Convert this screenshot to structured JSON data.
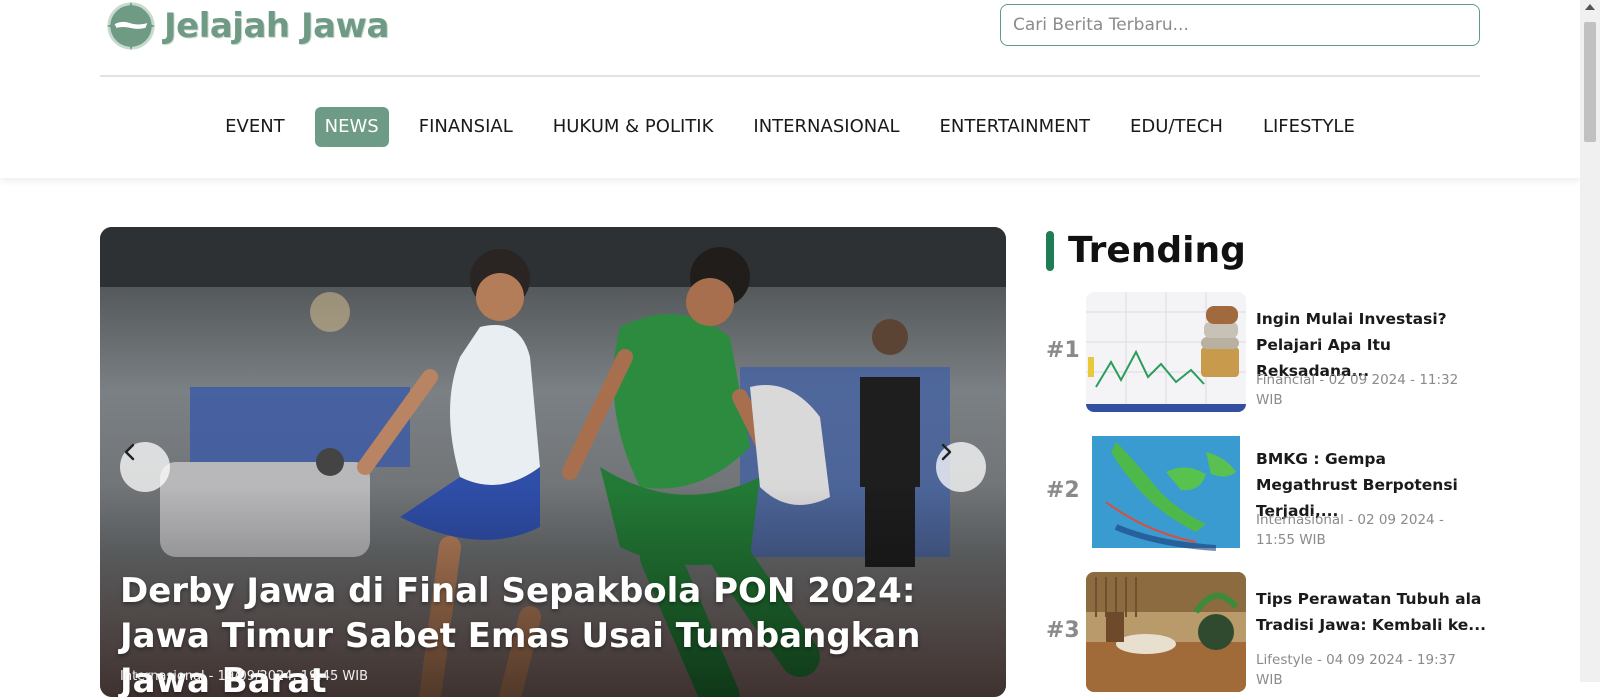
{
  "header": {
    "logo_text": "Jelajah Jawa",
    "search_placeholder": "Cari Berita Terbaru..."
  },
  "nav": {
    "items": [
      {
        "label": "EVENT",
        "active": false
      },
      {
        "label": "NEWS",
        "active": true
      },
      {
        "label": "FINANSIAL",
        "active": false
      },
      {
        "label": "HUKUM & POLITIK",
        "active": false
      },
      {
        "label": "INTERNASIONAL",
        "active": false
      },
      {
        "label": "ENTERTAINMENT",
        "active": false
      },
      {
        "label": "EDU/TECH",
        "active": false
      },
      {
        "label": "LIFESTYLE",
        "active": false
      }
    ]
  },
  "hero": {
    "title": "Derby Jawa di Final Sepakbola PON 2024: Jawa Timur Sabet Emas Usai Tumbangkan Jawa Barat",
    "meta": "Internasional - 19/09/2024, 19:45 WIB",
    "prev_icon": "chevron-left-icon",
    "next_icon": "chevron-right-icon"
  },
  "trending": {
    "title": "Trending",
    "items": [
      {
        "rank": "#1",
        "headline": "Ingin Mulai Investasi? Pelajari Apa Itu Reksadana...",
        "meta": "Financial - 02 09 2024 - 11:32 WIB"
      },
      {
        "rank": "#2",
        "headline": "BMKG : Gempa Megathrust Berpotensi Terjadi,...",
        "meta": "Internasional - 02 09 2024 - 11:55 WIB"
      },
      {
        "rank": "#3",
        "headline": "Tips Perawatan Tubuh ala Tradisi Jawa: Kembali ke...",
        "meta": "Lifestyle - 04 09 2024 - 19:37 WIB"
      }
    ]
  },
  "colors": {
    "brand": "#6f9a84",
    "nav_active": "#6d9b86",
    "trend_accent": "#1e7d55"
  }
}
